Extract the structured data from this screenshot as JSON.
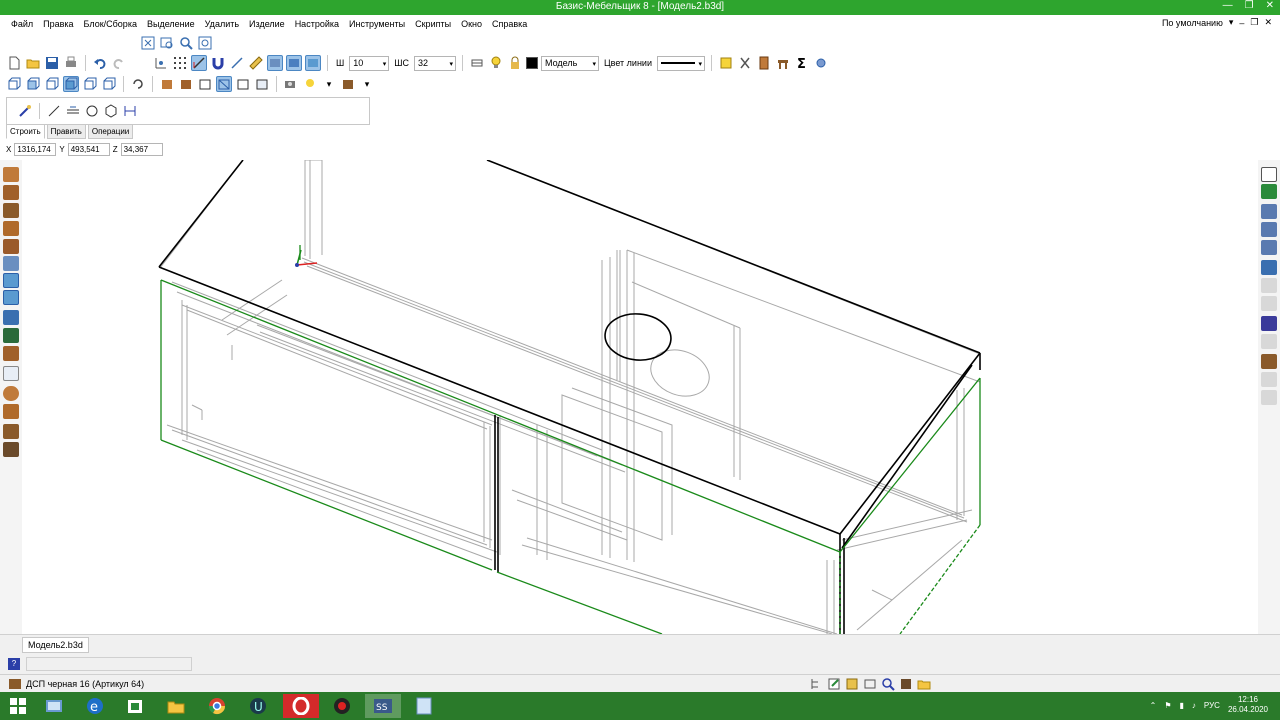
{
  "window": {
    "title": "Базис-Мебельщик 8 - [Модель2.b3d]",
    "controls": [
      "—",
      "❐",
      "✕"
    ]
  },
  "menu": {
    "items": [
      "Файл",
      "Правка",
      "Блок/Сборка",
      "Выделение",
      "Удалить",
      "Изделие",
      "Настройка",
      "Инструменты",
      "Скрипты",
      "Окно",
      "Справка"
    ],
    "preset": "По умолчанию",
    "mdi_controls": [
      "–",
      "❐",
      "✕"
    ]
  },
  "toolbar": {
    "width_label": "Ш",
    "width_value": "10",
    "snap_label": "ШС",
    "snap_value": "32",
    "layer_value": "Модель",
    "line_color_label": "Цвет линии",
    "layer_color": "#000000"
  },
  "build_panel": {
    "tabs": [
      "Строить",
      "Править",
      "Операции"
    ],
    "active_tab": "Строить"
  },
  "coords": {
    "x_label": "X",
    "x_value": "1316,174",
    "y_label": "Y",
    "y_value": "493,541",
    "z_label": "Z",
    "z_value": "34,367"
  },
  "document_tab": "Модель2.b3d",
  "status": {
    "material": "ДСП черная 16 (Артикул 64)"
  },
  "taskbar": {
    "language": "РУС",
    "time": "12:16",
    "date": "26.04.2020",
    "apps": [
      "start-icon",
      "explorer-icon",
      "edge-icon",
      "store-icon",
      "files-icon",
      "chrome-icon",
      "app-u-icon",
      "opera-icon",
      "app-red-icon",
      "bazis-icon",
      "calc-icon"
    ]
  },
  "colors": {
    "titlebar": "#2ea52e",
    "taskbar": "#2a7a2a",
    "selection_green": "#1a8a1a",
    "highlight": "#9cc3e8"
  }
}
